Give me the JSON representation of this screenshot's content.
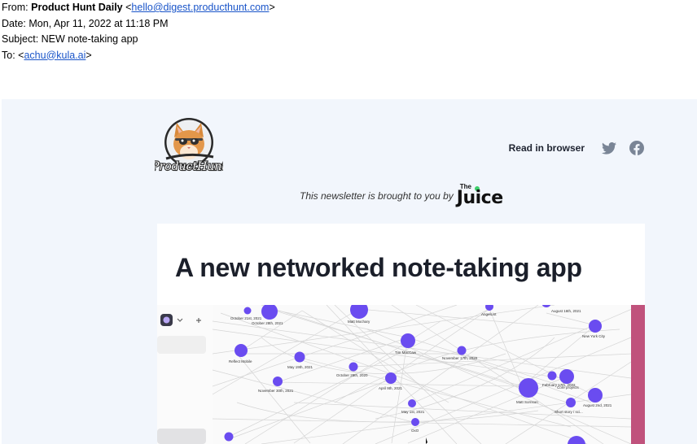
{
  "email": {
    "from_label": "From:",
    "from_name": "Product Hunt Daily",
    "from_email": "hello@digest.producthunt.com",
    "date_label": "Date:",
    "date": "Mon, Apr 11, 2022 at 11:18 PM",
    "subject_label": "Subject:",
    "subject": "NEW note-taking app",
    "to_label": "To:",
    "to_email": "achu@kula.ai"
  },
  "newsletter": {
    "logo_text": "ProductHunt",
    "read_in_browser": "Read in browser",
    "sponsor_text": "This newsletter is brought to you by",
    "sponsor_brand_small": "The",
    "sponsor_brand": "Juice",
    "headline": "A new networked note-taking app"
  },
  "graph_labels": [
    "October 21st, 2021",
    "October 28th, 2021",
    "Matt Mochary",
    "AngelList",
    "August 16th, 2021",
    "New York City",
    "Tim MacCaw",
    "November 17th, 2020",
    "Reflect Mobile",
    "May 19th, 2021",
    "October 28th, 2020",
    "November 30th, 2021",
    "April 9th, 2021",
    "February 17th, 2022",
    "Core projects",
    "Matt Sornson",
    "August 2nd, 2021",
    "May 1st, 2021",
    "Short story / sci...",
    "OxO"
  ],
  "colors": {
    "panel_bg": "#f2f6fc",
    "node": "#6a4cf0",
    "link": "#1a55c9",
    "app_accent": "#c0527c"
  }
}
